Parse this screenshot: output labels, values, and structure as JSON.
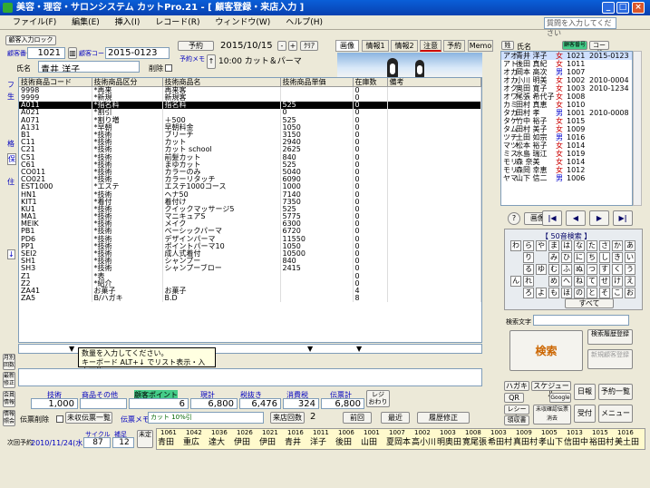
{
  "window": {
    "title": "美容・理容・サロンシステム カットPro.21 - [ 顧客登録・来店入力 ]"
  },
  "menu": [
    "ファイル(F)",
    "編集(E)",
    "挿入(I)",
    "レコード(R)",
    "ウィンドウ(W)",
    "ヘルプ(H)"
  ],
  "help_placeholder": "質問を入力してください",
  "header": {
    "customer_lock": "顧客入力ロック",
    "customer_no_label": "顧客番号",
    "customer_no": "1021",
    "customer_code_label": "顧客コード",
    "customer_code": "2015-0123",
    "name_label": "氏名",
    "name": "青井 洋子",
    "delete_label": "削除",
    "yoyaku_label": "予約",
    "date": "2015/10/15",
    "minus": "-",
    "plus": "+",
    "clear": "ｸﾘｱ",
    "yoyaku_memo_label": "予約メモ",
    "time_memo": "10:00 カット＆パーマ"
  },
  "tabs": [
    "画像",
    "情報1",
    "情報2",
    "注意",
    "予約",
    "Memo"
  ],
  "grid": {
    "headers": [
      "技術商品コード",
      "技術商品区分",
      "技術商品名",
      "技術商品単価",
      "在庫数",
      "備考"
    ],
    "rows": [
      [
        "9998",
        "*再来",
        "再来客",
        "",
        "0",
        ""
      ],
      [
        "9999",
        "*新規",
        "新規客",
        "",
        "0",
        ""
      ],
      [
        "A011",
        "*指名料",
        "指名料",
        "525",
        "0",
        ""
      ],
      [
        "A021",
        "*割引",
        "",
        "0",
        "0",
        ""
      ],
      [
        "A071",
        "*割り増",
        "＋500",
        "525",
        "0",
        ""
      ],
      [
        "A131",
        "*早朝",
        "早朝料金",
        "1050",
        "0",
        ""
      ],
      [
        "B1",
        "*技術",
        "ブリーチ",
        "3150",
        "0",
        ""
      ],
      [
        "C11",
        "*技術",
        "カット",
        "2940",
        "0",
        ""
      ],
      [
        "C21",
        "*技術",
        "カット school",
        "2625",
        "0",
        ""
      ],
      [
        "C51",
        "*技術",
        "前髪カット",
        "840",
        "0",
        ""
      ],
      [
        "C61",
        "*技術",
        "まゆカット",
        "525",
        "0",
        ""
      ],
      [
        "CO011",
        "*技術",
        "カラーのみ",
        "5040",
        "0",
        ""
      ],
      [
        "CO021",
        "*技術",
        "カラーリタッチ",
        "6090",
        "0",
        ""
      ],
      [
        "EST1000",
        "*エステ",
        "エステ1000コース",
        "1000",
        "0",
        ""
      ],
      [
        "HN1",
        "*技術",
        "ヘナ50",
        "7140",
        "0",
        ""
      ],
      [
        "KIT1",
        "*着付",
        "着付け",
        "7350",
        "0",
        ""
      ],
      [
        "KU1",
        "*技術",
        "クイックマッサージ5",
        "525",
        "0",
        ""
      ],
      [
        "MA1",
        "*技術",
        "マニキュアS",
        "5775",
        "0",
        ""
      ],
      [
        "MEIK",
        "*技術",
        "メイク",
        "6300",
        "0",
        ""
      ],
      [
        "PB1",
        "*技術",
        "ベーシックパーマ",
        "6720",
        "0",
        ""
      ],
      [
        "PD6",
        "*技術",
        "デザインパーマ",
        "11550",
        "0",
        ""
      ],
      [
        "PP1",
        "*技術",
        "ポイントパーマ10",
        "1050",
        "0",
        ""
      ],
      [
        "SEI2",
        "*技術",
        "成人式着付",
        "10500",
        "0",
        ""
      ],
      [
        "SH1",
        "*技術",
        "シャンプー",
        "840",
        "0",
        ""
      ],
      [
        "SH3",
        "*技術",
        "シャンプーブロー",
        "2415",
        "0",
        ""
      ],
      [
        "Z1",
        "*表",
        "",
        "",
        "0",
        ""
      ],
      [
        "Z2",
        "*紹介",
        "",
        "",
        "0",
        ""
      ],
      [
        "ZA41",
        "お菓子",
        "お菓子",
        "",
        "4",
        ""
      ],
      [
        "ZA5",
        "B/ハガキ",
        "B.D",
        "",
        "8",
        ""
      ]
    ]
  },
  "hint": {
    "line1": "数量を入力してください。",
    "line2": "キーボード ALT+↓ でリスト表示・入力可能"
  },
  "left_side": [
    "フ",
    "生",
    "格",
    "保",
    "住",
    "↓"
  ],
  "left_buttons": [
    "月別回数",
    "最新修正",
    "会員情報",
    "情報照会"
  ],
  "totals": {
    "labels": [
      "技術",
      "商品その他",
      "顧客ポイント",
      "現計",
      "税抜き",
      "消費税",
      "伝票計"
    ],
    "values": [
      "1,000",
      "",
      "6",
      "6,800",
      "6,476",
      "324",
      "6,800"
    ],
    "reji": "レジ\nおわり"
  },
  "footer": {
    "slip_delete": "伝票削除",
    "prev_slip": "未収伝票一覧",
    "slip_memo_label": "伝票メモ",
    "slip_memo": "カット 10%引",
    "visit_count_label": "来店回数",
    "visit_count": "2",
    "prev": "前回",
    "latest": "最近",
    "history": "履歴修正"
  },
  "next_visit": {
    "label": "次回予約",
    "date": "2010/11/24(水)",
    "cycle_label": "サイクル",
    "cycle": "87",
    "hosoku_label": "補足",
    "hosoku": "12",
    "mitei": "未定"
  },
  "customers": {
    "head_label": "氏名",
    "code_label": "顧客番号",
    "code_btn": "コード",
    "rows": [
      [
        "アオ",
        "青井 洋子",
        "女",
        "1021",
        "2015-0123"
      ],
      [
        "アト",
        "後田 真紀",
        "女",
        "1011",
        ""
      ],
      [
        "オカ",
        "岡本 高次",
        "男",
        "1007",
        ""
      ],
      [
        "オカ",
        "小川 明美",
        "女",
        "1002",
        "2010-0004"
      ],
      [
        "オク",
        "奥田 寛子",
        "女",
        "1003",
        "2010-1234"
      ],
      [
        "オワ",
        "尾張 希代子",
        "女",
        "1008",
        ""
      ],
      [
        "カミ",
        "田村 真恵",
        "女",
        "1010",
        ""
      ],
      [
        "タカ",
        "田村 孝",
        "男",
        "1001",
        "2010-0008"
      ],
      [
        "タケ",
        "竹中 裕子",
        "女",
        "1015",
        ""
      ],
      [
        "タム",
        "田村 美子",
        "女",
        "1009",
        ""
      ],
      [
        "ツチ",
        "土田 如宗",
        "男",
        "1016",
        ""
      ],
      [
        "マツ",
        "松本 裕子",
        "女",
        "1014",
        ""
      ],
      [
        "ミス",
        "水島 瑞江",
        "女",
        "1019",
        ""
      ],
      [
        "モリ",
        "森 奈美",
        "女",
        "1014",
        ""
      ],
      [
        "モリ",
        "森岡 幸恵",
        "女",
        "1012",
        ""
      ],
      [
        "ヤマ",
        "山下 信二",
        "男",
        "1006",
        ""
      ]
    ]
  },
  "image_list": "画像集",
  "kana": {
    "title": "【 50音検索 】",
    "rows": [
      [
        "わ",
        "ら",
        "や",
        "ま",
        "は",
        "な",
        "た",
        "さ",
        "か",
        "あ"
      ],
      [
        "",
        "り",
        "",
        "み",
        "ひ",
        "に",
        "ち",
        "し",
        "き",
        "い"
      ],
      [
        "",
        "る",
        "ゆ",
        "む",
        "ふ",
        "ぬ",
        "つ",
        "す",
        "く",
        "う"
      ],
      [
        "ん",
        "れ",
        "",
        "め",
        "へ",
        "ね",
        "て",
        "せ",
        "け",
        "え"
      ],
      [
        "",
        "ろ",
        "よ",
        "も",
        "ほ",
        "の",
        "と",
        "そ",
        "こ",
        "お"
      ]
    ],
    "all": "すべて",
    "search_char_label": "検索文字"
  },
  "right_buttons": {
    "search": "検索",
    "history_reg": "検索履歴登録",
    "new_reg": "新規顧客登録",
    "hagaki": "ハガキ",
    "schedule": "スケジュール",
    "daily": "日報",
    "yoyaku_list": "予約一覧",
    "qr": "QR",
    "google": "Google",
    "receipt": "レシート",
    "unpaid_receipt": "領収書",
    "unpaid_confirm": "未収確認伝票消去",
    "uketsuke": "受付",
    "menu": "メニュー"
  },
  "bottom_names": [
    [
      "1061",
      "青田"
    ],
    [
      "1042",
      "重広"
    ],
    [
      "1036",
      "達大"
    ],
    [
      "1026",
      "伊田"
    ],
    [
      "1021",
      "伊田"
    ],
    [
      "1016",
      "青井"
    ],
    [
      "1011",
      "洋子"
    ],
    [
      "1006",
      "後田"
    ],
    [
      "1001",
      "山田"
    ],
    [
      "1007",
      "夏岡本"
    ],
    [
      "1002",
      "高小川"
    ],
    [
      "1003",
      "明奥田"
    ],
    [
      "1008",
      "寛尾張"
    ],
    [
      "1003",
      "希田村"
    ],
    [
      "1009",
      "真田村"
    ],
    [
      "1005",
      "孝山下"
    ],
    [
      "1013",
      "信田中"
    ],
    [
      "1015",
      "裕田村"
    ],
    [
      "1016",
      "美土田"
    ]
  ],
  "colors": {
    "title_bar": "#0a5fd8",
    "selected_row": "#000000",
    "grid_bg": "#ffffff"
  }
}
